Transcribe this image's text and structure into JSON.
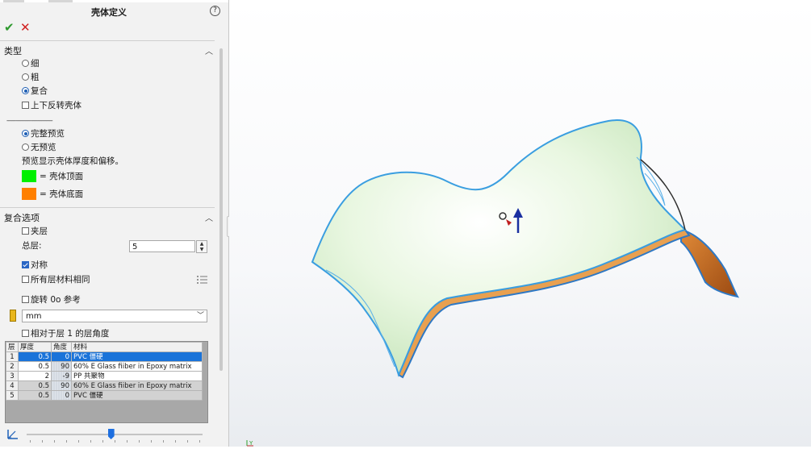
{
  "panel": {
    "title": "壳体定义",
    "help_glyph": "?",
    "ok_glyph": "✔",
    "cancel_glyph": "✕"
  },
  "type_section": {
    "header": "类型",
    "options": [
      "细",
      "粗",
      "复合"
    ],
    "selected": "复合",
    "flip_label": "上下反转壳体",
    "flip_checked": false
  },
  "preview_section": {
    "separator": "------------------------------",
    "full_preview": "完整预览",
    "no_preview": "无预览",
    "selected": "完整预览",
    "note": "预览显示壳体厚度和偏移。",
    "top_label": "= 壳体顶面",
    "top_color": "#00f000",
    "bottom_label": "= 壳体底面",
    "bottom_color": "#ff7f00"
  },
  "composite_section": {
    "header": "复合选项",
    "sandwich_label": "夹层",
    "sandwich_checked": false,
    "total_layers_label": "总层:",
    "total_layers_value": "5",
    "symmetric_label": "对称",
    "symmetric_checked": true,
    "same_material_label": "所有层材料相同",
    "same_material_checked": false,
    "rotate_ref_label": "旋转 0o 参考",
    "rotate_ref_checked": false,
    "unit": "mm",
    "relative_angle_label": "相对于层 1 的层角度",
    "relative_angle_checked": false
  },
  "ply_table": {
    "headers": [
      "层",
      "厚度",
      "角度",
      "材料"
    ],
    "rows": [
      {
        "n": "1",
        "thickness": "0.5",
        "angle": "0",
        "material": "PVC 僵硬"
      },
      {
        "n": "2",
        "thickness": "0.5",
        "angle": "90",
        "material": "60% E Glass fiiber in Epoxy matrix"
      },
      {
        "n": "3",
        "thickness": "2",
        "angle": "-9",
        "material": "PP 共聚物"
      },
      {
        "n": "4",
        "thickness": "0.5",
        "angle": "90",
        "material": "60% E Glass fiiber in Epoxy matrix"
      },
      {
        "n": "5",
        "thickness": "0.5",
        "angle": "0",
        "material": "PVC 僵硬"
      }
    ],
    "selected_row": 1
  },
  "slider": {
    "position_fraction": 0.48
  },
  "model": {
    "top_color": "#e6f7df",
    "edge_color": "#3a9ee0",
    "bottom_color": "#c0621a",
    "arrow_color": "#1a2fa0"
  },
  "triad": {
    "y_label": "Y"
  }
}
